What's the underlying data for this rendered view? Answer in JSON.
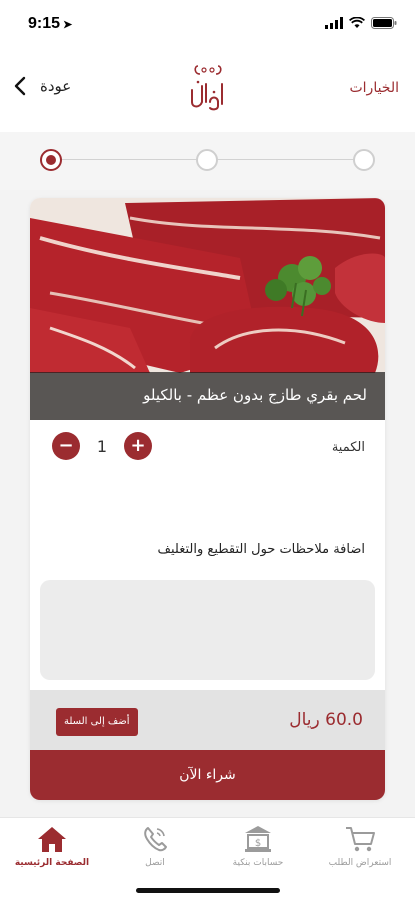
{
  "status_bar": {
    "time": "9:15"
  },
  "nav": {
    "back_label": "عودة",
    "options_label": "الخيارات",
    "logo_text": "الجابري"
  },
  "steps": {
    "count": 3,
    "active_index": 3
  },
  "product": {
    "title": "لحم بقري طازج بدون عظم - بالكيلو",
    "quantity_label": "الكمية",
    "quantity": "1",
    "minus_symbol": "−",
    "plus_symbol": "+",
    "notes_label": "اضافة ملاحظات حول التقطيع والتغليف",
    "notes_value": "",
    "price": "60.0 ريال",
    "add_to_cart_label": "أضف إلى السلة",
    "buy_now_label": "شراء الآن"
  },
  "tab_bar": {
    "tabs": [
      {
        "label": "استعراض الطلب",
        "icon": "cart-icon"
      },
      {
        "label": "حسابات بنكية",
        "icon": "bank-icon"
      },
      {
        "label": "اتصل",
        "icon": "phone-icon"
      },
      {
        "label": "الصفحة الرئيسية",
        "icon": "home-icon"
      }
    ],
    "active_tab": "الصفحة الرئيسية"
  },
  "colors": {
    "accent": "#9b2c30",
    "background": "#f3f3f3",
    "inactive": "#9b9b9b"
  }
}
